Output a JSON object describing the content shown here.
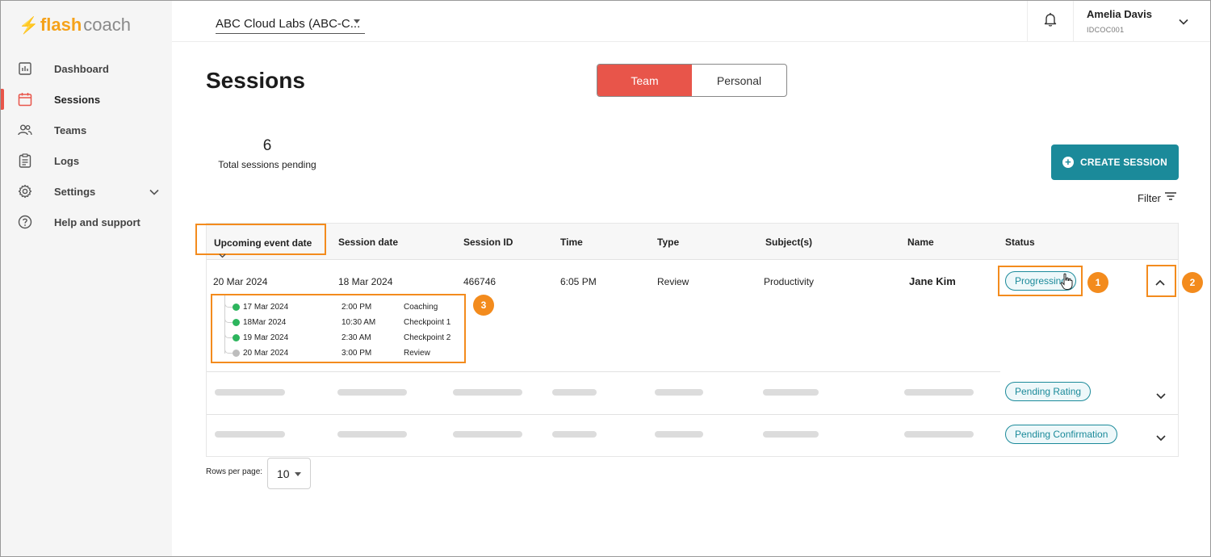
{
  "logo": {
    "flash": "flash",
    "coach": "coach"
  },
  "sidebar": {
    "items": [
      {
        "label": "Dashboard",
        "icon": "dashboard-icon"
      },
      {
        "label": "Sessions",
        "icon": "calendar-icon",
        "active": true
      },
      {
        "label": "Teams",
        "icon": "people-icon"
      },
      {
        "label": "Logs",
        "icon": "clipboard-icon"
      },
      {
        "label": "Settings",
        "icon": "gear-icon",
        "expandable": true
      },
      {
        "label": "Help and support",
        "icon": "help-icon"
      }
    ]
  },
  "header": {
    "org": "ABC Cloud Labs (ABC-C...",
    "user_name": "Amelia Davis",
    "user_id": "IDCOC001"
  },
  "page": {
    "title": "Sessions",
    "toggle": {
      "team": "Team",
      "personal": "Personal",
      "selected": "Team"
    },
    "pending_count": "6",
    "pending_caption": "Total sessions pending",
    "create_label": "CREATE SESSION",
    "filter_label": "Filter"
  },
  "table": {
    "columns": [
      "Upcoming event date",
      "Session date",
      "Session ID",
      "Time",
      "Type",
      "Subject(s)",
      "Name",
      "Status"
    ],
    "row1": {
      "upcoming": "20 Mar 2024",
      "session_date": "18 Mar 2024",
      "session_id": "466746",
      "time": "6:05 PM",
      "type": "Review",
      "subject": "Productivity",
      "name": "Jane Kim",
      "status": "Progressing"
    },
    "timeline": [
      {
        "date": "17 Mar 2024",
        "time": "2:00 PM",
        "kind": "Coaching",
        "state": "done"
      },
      {
        "date": "18Mar 2024",
        "time": "10:30 AM",
        "kind": "Checkpoint 1",
        "state": "done"
      },
      {
        "date": "19 Mar 2024",
        "time": "2:30 AM",
        "kind": "Checkpoint 2",
        "state": "done"
      },
      {
        "date": "20 Mar 2024",
        "time": "3:00 PM",
        "kind": "Review",
        "state": "pending"
      }
    ],
    "row2_status": "Pending Rating",
    "row3_status": "Pending Confirmation"
  },
  "markers": [
    "1",
    "2",
    "3"
  ],
  "pagination": {
    "label": "Rows per page:",
    "value": "10"
  },
  "colors": {
    "accent": "#e8554a",
    "teal": "#1b8a9a",
    "brand": "#f5a21b",
    "highlight": "#f38b1d",
    "done": "#2db55d"
  }
}
